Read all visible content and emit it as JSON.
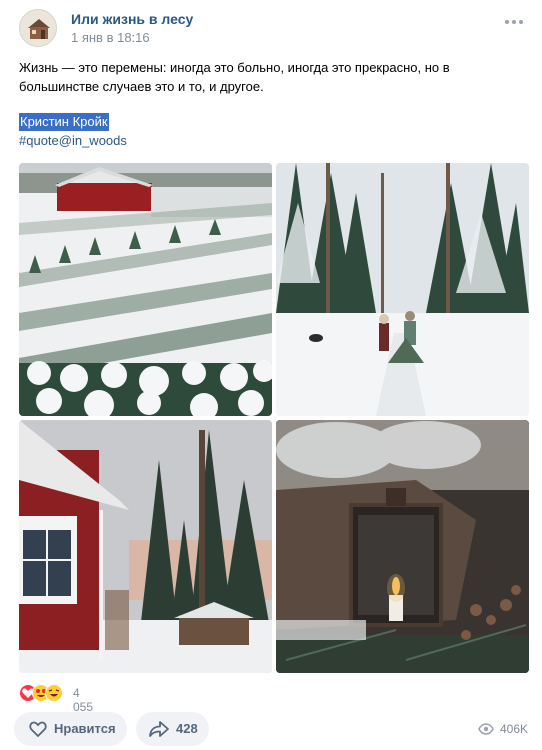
{
  "post": {
    "group_name": "Или жизнь в лесу",
    "date": "1 янв в 18:16",
    "text": "Жизнь — это перемены: иногда это больно, иногда это прекрасно, но в большинстве случаев это и то, и другое.",
    "author": "Кристин Кройк",
    "hashtag": "#quote@in_woods"
  },
  "photos": [
    {
      "description": "snowy tree farm with red barn"
    },
    {
      "description": "two people pulling a tree through snowy forest"
    },
    {
      "description": "red house and snowy pines at dusk"
    },
    {
      "description": "lantern with candle among heather and pine"
    }
  ],
  "reactions": {
    "icons": [
      "heart-icon",
      "heart-eyes-emoji-icon",
      "laughing-emoji-icon"
    ],
    "count": "4 055"
  },
  "actions": {
    "like_label": "Нравится",
    "share_count": "428",
    "views_count": "406K"
  },
  "colors": {
    "link": "#2a5885",
    "muted": "#818c99",
    "button_bg": "#f0f2f5",
    "highlight": "#3a6fc4"
  }
}
